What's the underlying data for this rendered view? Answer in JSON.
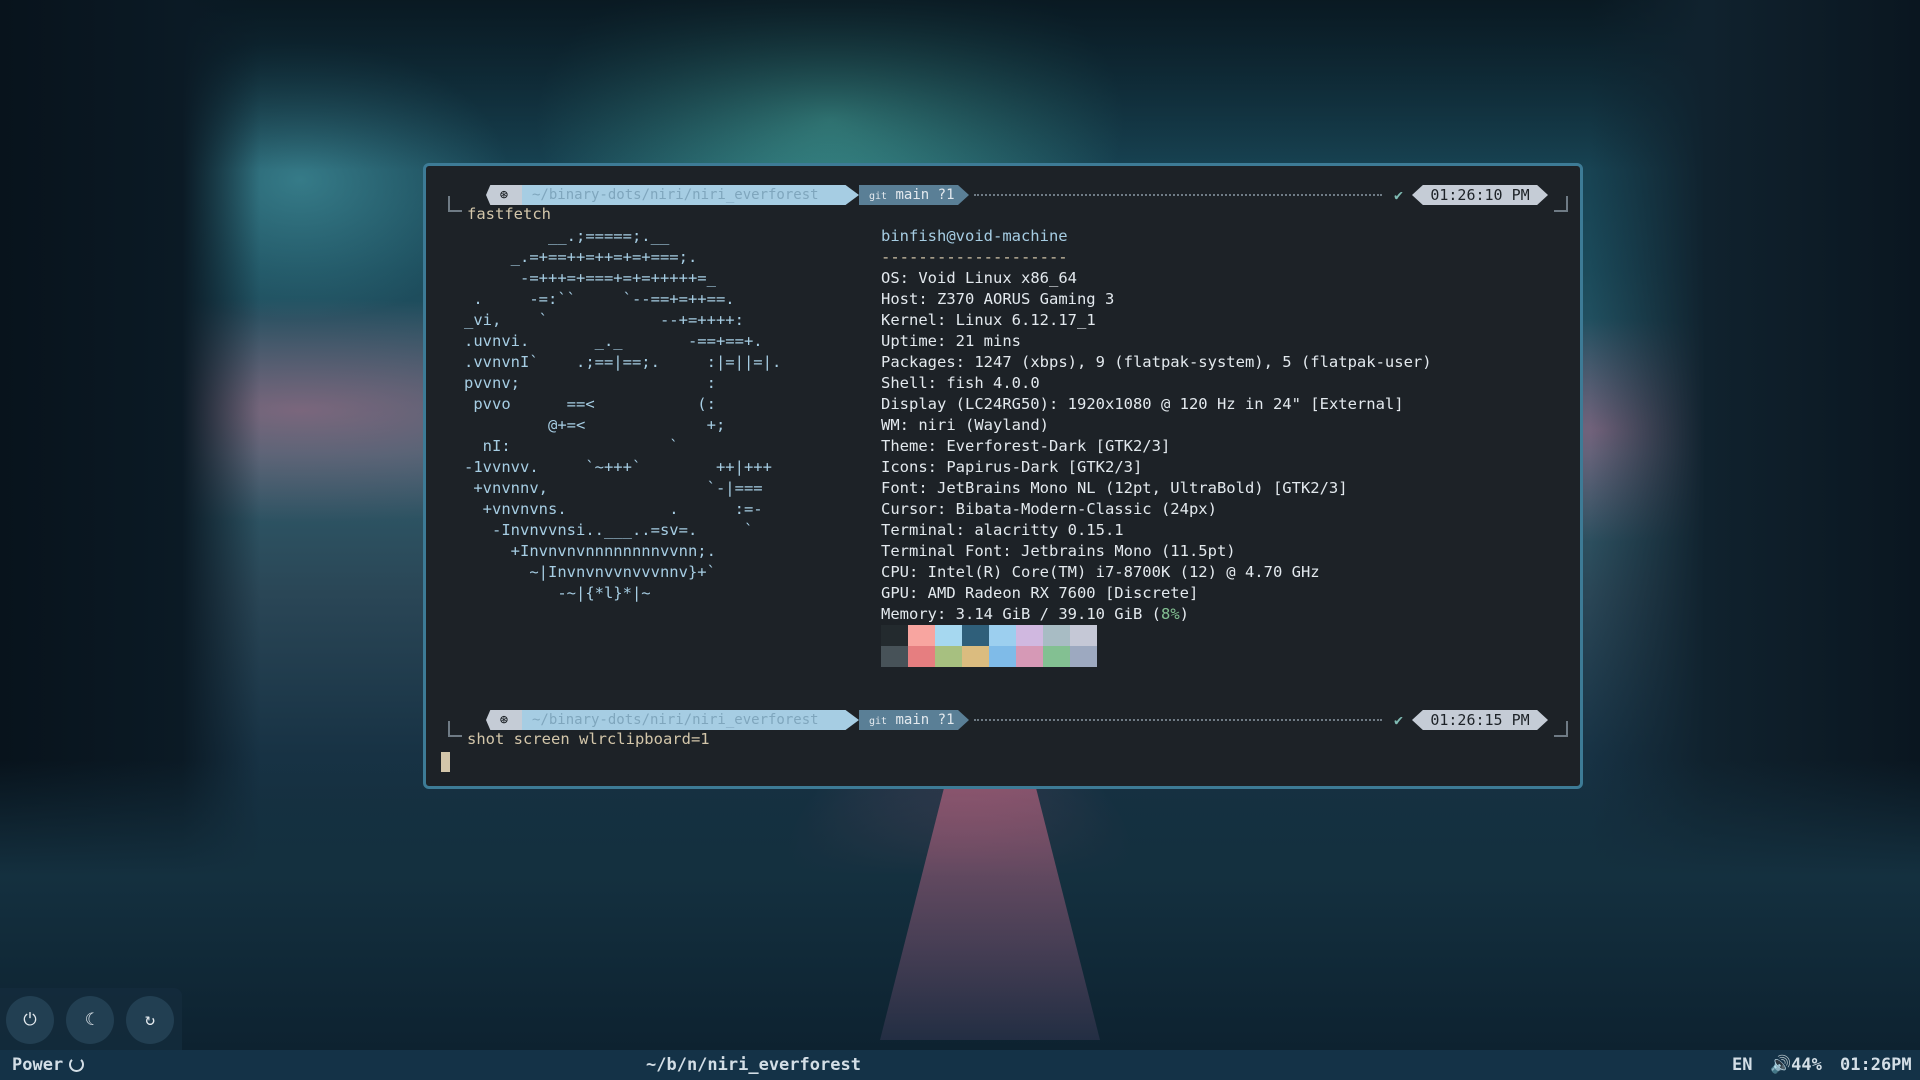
{
  "terminal": {
    "prompt1": {
      "icon": "⊛",
      "path": "~/binary-dots/niri/niri_everforest",
      "git_prefix": "git",
      "git": "main ?1",
      "check": "✔",
      "time": "01:26:10 PM"
    },
    "command1": "fastfetch",
    "logo": [
      "         __.;=====;.__",
      "     _.=+==++=++=+=+===;.",
      "      -=+++=+===+=+=+++++=_",
      " .     -=:``     `--==+=++==.",
      "_vi,    `            --+=++++:",
      ".uvnvi.       _._       -==+==+.",
      ".vvnvnI`    .;==|==;.     :|=||=|.",
      "pvvnv;                    :",
      " pvvo      ==<           (:",
      "         @+=<             +;",
      "  nI:                 `",
      "-1vvnvv.     `~+++`        ++|+++",
      " +vnvnnv,                 `-|===",
      "  +vnvnvns.           .      :=-",
      "   -Invnvvnsi..___..=sv=.     `",
      "     +Invnvnvnnnnnnnnvvnn;.",
      "       ~|Invnvnvvnvvvnnv}+`",
      "          -~|{*l}*|~"
    ],
    "info": {
      "user": "binfish@void-machine",
      "separator": "--------------------",
      "rows": [
        {
          "key": "OS",
          "value": "Void Linux x86_64"
        },
        {
          "key": "Host",
          "value": "Z370 AORUS Gaming 3"
        },
        {
          "key": "Kernel",
          "value": "Linux 6.12.17_1"
        },
        {
          "key": "Uptime",
          "value": "21 mins"
        },
        {
          "key": "Packages",
          "value": "1247 (xbps), 9 (flatpak-system), 5 (flatpak-user)"
        },
        {
          "key": "Shell",
          "value": "fish 4.0.0"
        },
        {
          "key": "Display (LC24RG50)",
          "value": "1920x1080 @ 120 Hz in 24\" [External]"
        },
        {
          "key": "WM",
          "value": "niri (Wayland)"
        },
        {
          "key": "Theme",
          "value": "Everforest-Dark [GTK2/3]"
        },
        {
          "key": "Icons",
          "value": "Papirus-Dark [GTK2/3]"
        },
        {
          "key": "Font",
          "value": "JetBrains Mono NL (12pt, UltraBold) [GTK2/3]"
        },
        {
          "key": "Cursor",
          "value": "Bibata-Modern-Classic (24px)"
        },
        {
          "key": "Terminal",
          "value": "alacritty 0.15.1"
        },
        {
          "key": "Terminal Font",
          "value": "Jetbrains Mono (11.5pt)"
        },
        {
          "key": "CPU",
          "value": "Intel(R) Core(TM) i7-8700K (12) @ 4.70 GHz"
        },
        {
          "key": "GPU",
          "value": "AMD Radeon RX 7600 [Discrete]"
        }
      ],
      "memory_key": "Memory",
      "memory_value": "3.14 GiB / 39.10 GiB (",
      "memory_pct": "8%",
      "memory_close": ")",
      "palette_top": [
        "#232a2e",
        "#f8a5a0",
        "#a6d8f0",
        "#2f5f7a",
        "#9ccfef",
        "#d0b8e0",
        "#a8bcc4",
        "#c5c8d6"
      ],
      "palette_bottom": [
        "#475258",
        "#e67e80",
        "#a7c080",
        "#dbbc7f",
        "#7fbbe8",
        "#d699b6",
        "#83c092",
        "#9da9c0"
      ]
    },
    "prompt2": {
      "icon": "⊛",
      "path": "~/binary-dots/niri/niri_everforest",
      "git_prefix": "git",
      "git": "main ?1",
      "check": "✔",
      "time": "01:26:15 PM"
    },
    "command2": "shot screen wlrclipboard=1"
  },
  "power_menu": {
    "power_icon": "⏻",
    "sleep_icon": "☾",
    "restart_icon": "↻"
  },
  "bar": {
    "power_label": "Power",
    "workspace_path": "~/b/n/niri_everforest",
    "lang": "EN",
    "volume": "🔊44%",
    "clock": "01:26PM"
  }
}
